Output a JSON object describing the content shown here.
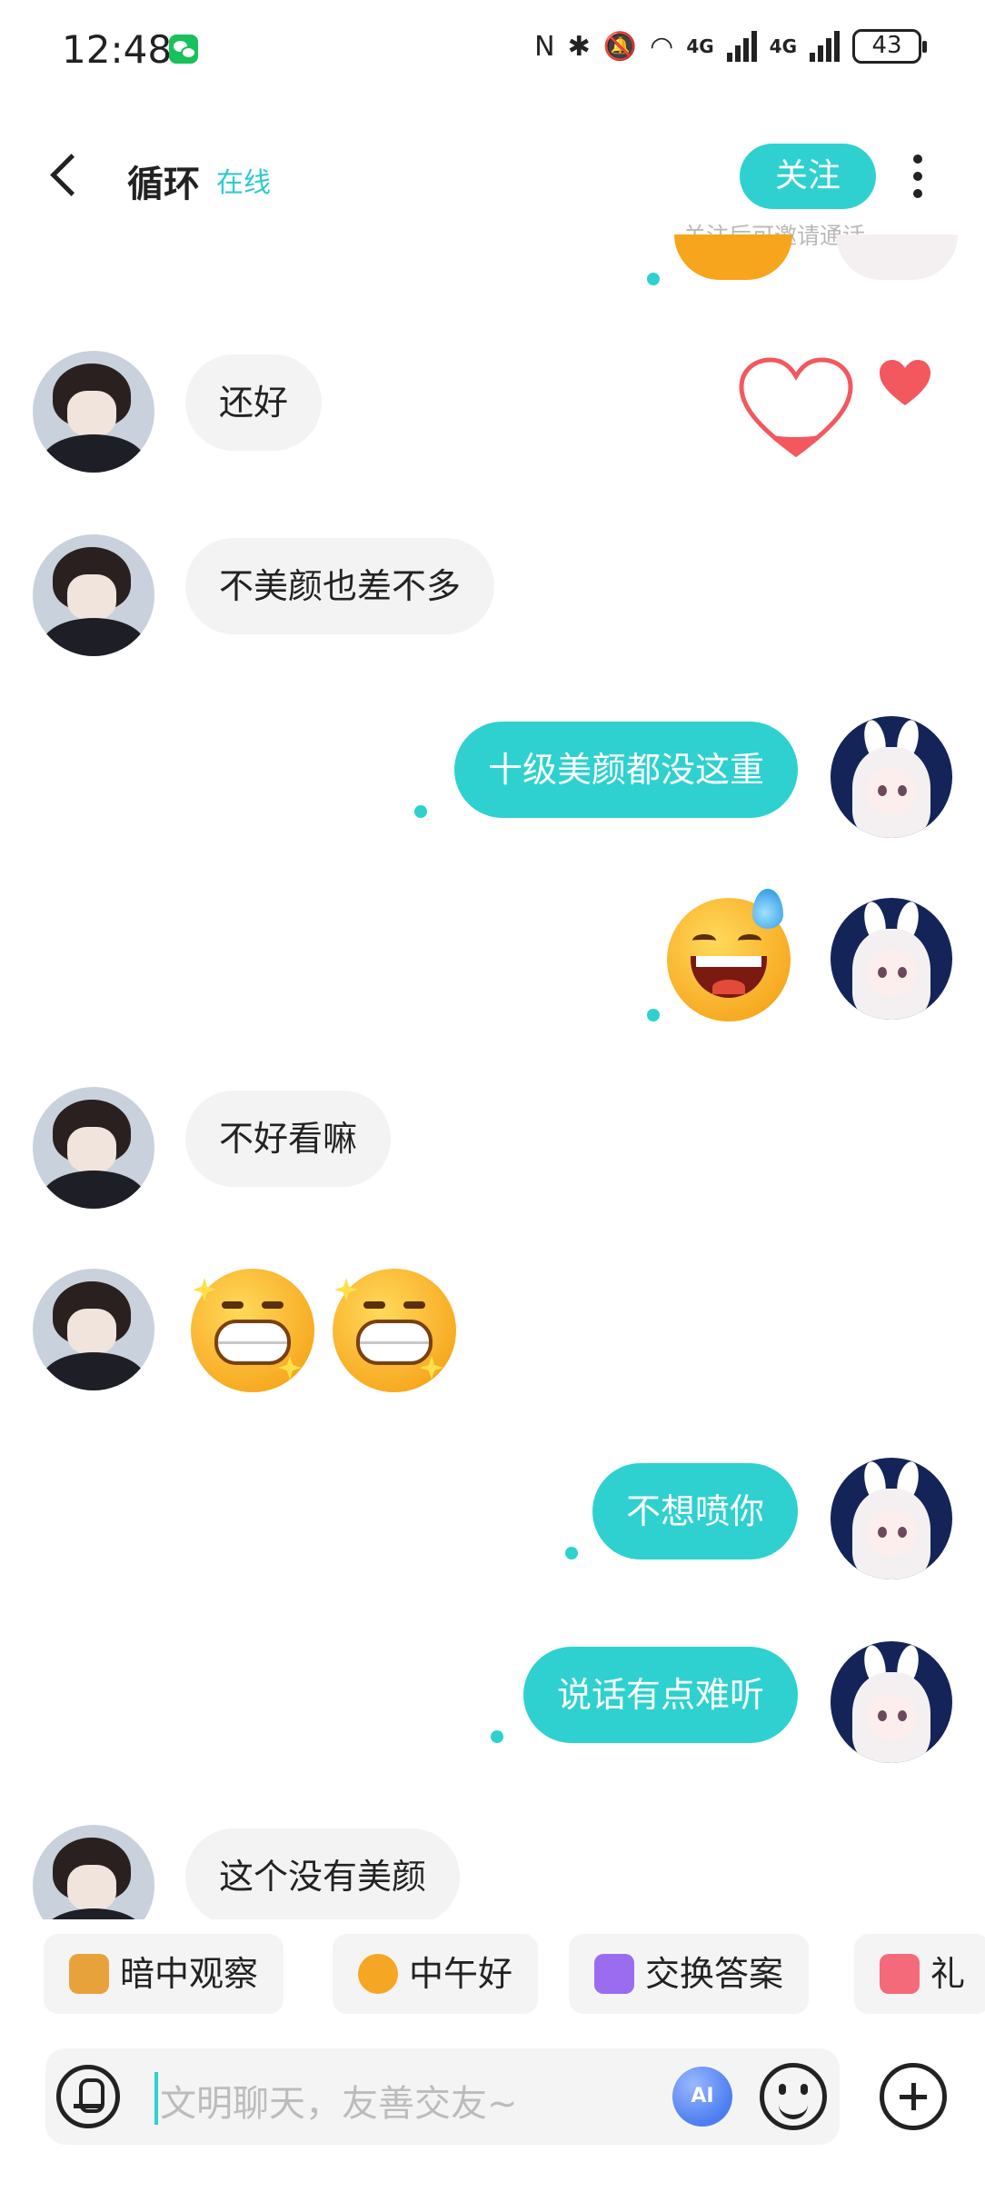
{
  "status_bar": {
    "time": "12:48",
    "net_label_1": "4G",
    "net_label_2": "4G",
    "battery": "43"
  },
  "header": {
    "title": "循环",
    "status": "在线",
    "follow_label": "关注",
    "follow_hint": "关注后可邀请通话"
  },
  "messages": [
    {
      "side": "in",
      "text": "还好"
    },
    {
      "side": "in",
      "text": "不美颜也差不多"
    },
    {
      "side": "out",
      "text": "十级美颜都没这重"
    },
    {
      "side": "out",
      "emoji": "sweat-smile-emoji"
    },
    {
      "side": "in",
      "text": "不好看嘛"
    },
    {
      "side": "in",
      "emoji": "grin-sparkle-emoji x2"
    },
    {
      "side": "out",
      "text": "不想喷你"
    },
    {
      "side": "out",
      "text": "说话有点难听"
    },
    {
      "side": "in",
      "text": "这个没有美颜"
    }
  ],
  "quick_replies": [
    {
      "label": "暗中观察",
      "icon": "peek-dog-icon"
    },
    {
      "label": "中午好",
      "icon": "sun-sunglasses-icon"
    },
    {
      "label": "交换答案",
      "icon": "swap-icon"
    },
    {
      "label": "礼",
      "icon": "gift-icon"
    }
  ],
  "input": {
    "placeholder": "文明聊天，友善交友~",
    "ai_label": "AI"
  },
  "colors": {
    "accent": "#2ed1cf",
    "incoming_bubble": "#f3f3f3",
    "heart": "#f2585e"
  }
}
